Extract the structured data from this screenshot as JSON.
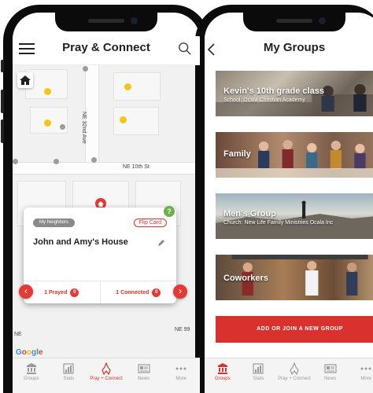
{
  "phone1": {
    "header": {
      "title": "Pray & Connect"
    },
    "map": {
      "streets": {
        "ave": "NE 32nd Ave",
        "st": "NE 10th St",
        "ne_left": "NE",
        "ne_right": "NE 99"
      },
      "attribution": {
        "g1": "G",
        "g2": "o",
        "g3": "o",
        "g4": "g",
        "g5": "l",
        "g6": "e"
      }
    },
    "card": {
      "badge": "My Neighbors",
      "flip": "Flip Card",
      "help": "?",
      "title": "John and Amy's House",
      "prayed_label": "1 Prayed",
      "prayed_count": "0",
      "connected_label": "1 Connected",
      "connected_count": "0",
      "prev": "‹",
      "next": "›"
    },
    "tabs": [
      {
        "label": "Groups",
        "icon": "groups-icon"
      },
      {
        "label": "Stats",
        "icon": "stats-icon"
      },
      {
        "label": "Pray + Connect",
        "icon": "pray-icon"
      },
      {
        "label": "News",
        "icon": "news-icon"
      },
      {
        "label": "More",
        "icon": "more-icon"
      }
    ]
  },
  "phone2": {
    "header": {
      "title": "My Groups"
    },
    "groups": [
      {
        "name": "Kevin's 10th grade class",
        "subtitle": "School: Ocala Christian Academy"
      },
      {
        "name": "Family",
        "subtitle": ""
      },
      {
        "name": "Men's Group",
        "subtitle": "Church: New Life Family Ministries Ocala Inc"
      },
      {
        "name": "Coworkers",
        "subtitle": ""
      }
    ],
    "add_button": "ADD OR JOIN A NEW GROUP",
    "tabs": [
      {
        "label": "Groups",
        "icon": "groups-icon"
      },
      {
        "label": "Stats",
        "icon": "stats-icon"
      },
      {
        "label": "Pray + Connect",
        "icon": "pray-icon"
      },
      {
        "label": "News",
        "icon": "news-icon"
      },
      {
        "label": "More",
        "icon": "more-icon"
      }
    ]
  },
  "colors": {
    "accent": "#d9322e",
    "pin_yellow": "#f5c518",
    "pin_gray": "#9c9c9c",
    "help_green": "#6ab04c"
  }
}
